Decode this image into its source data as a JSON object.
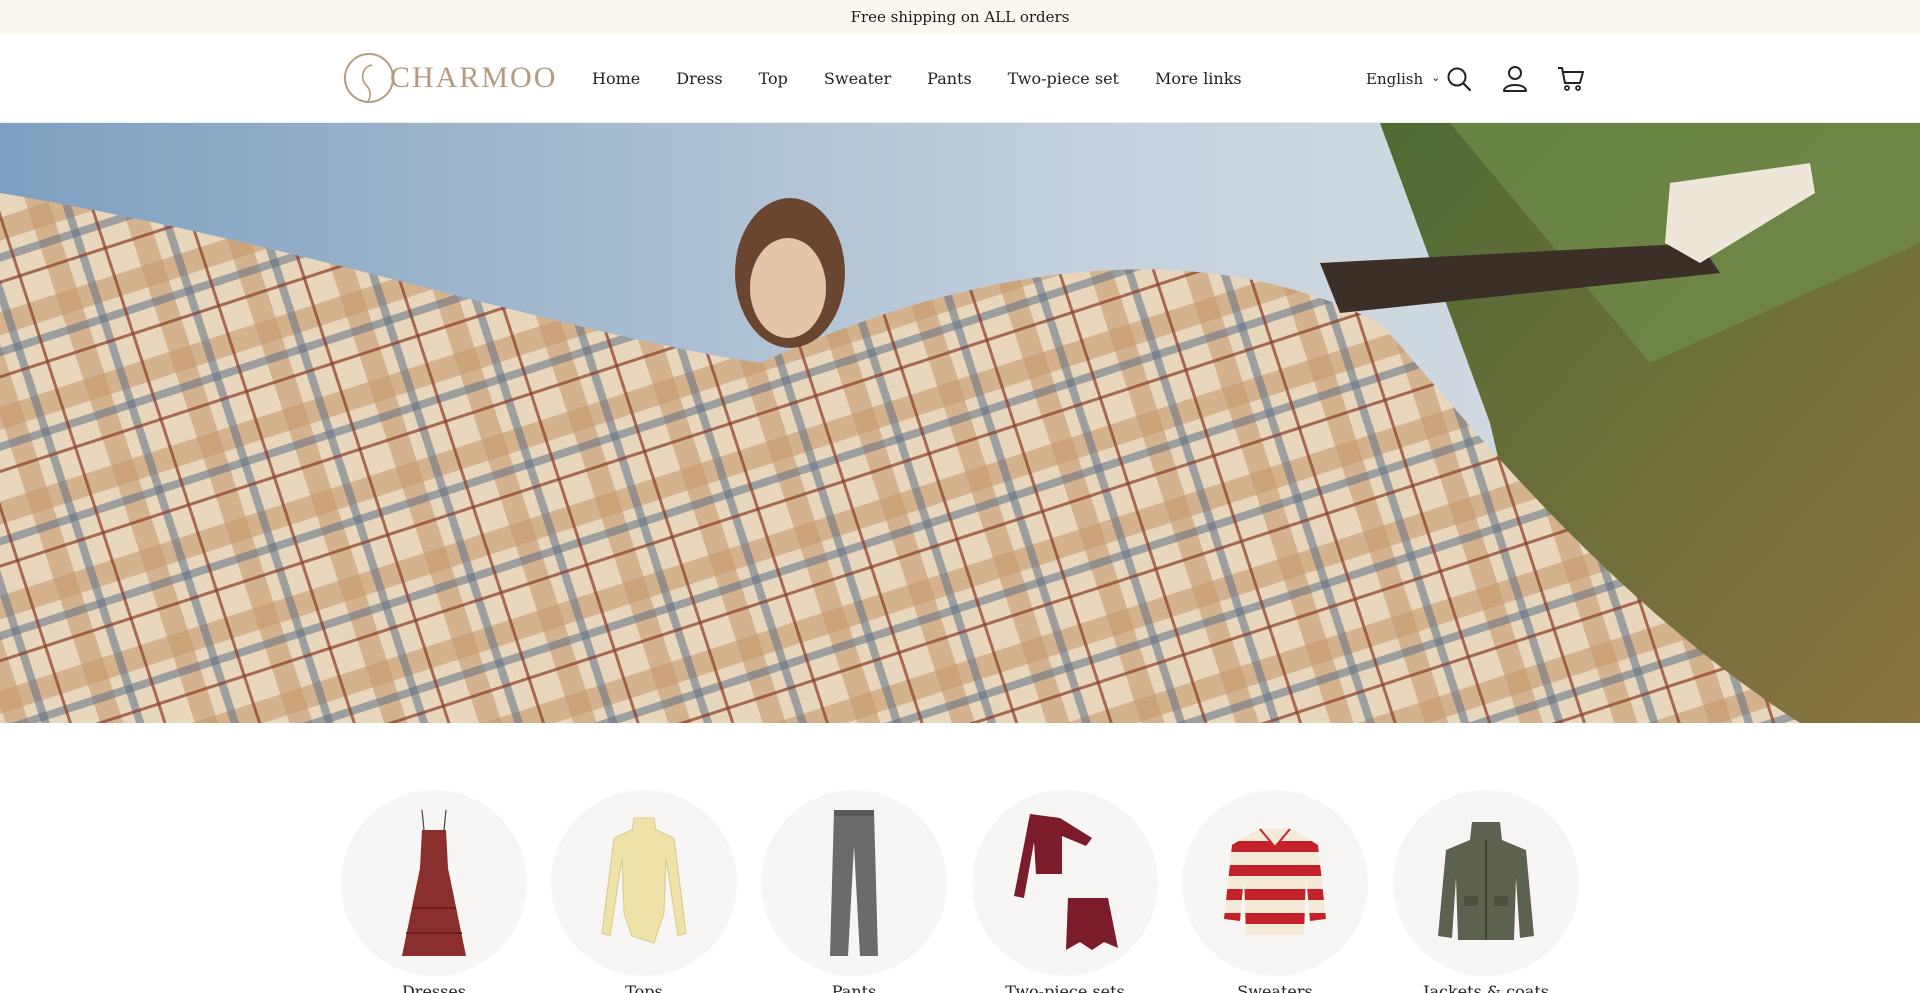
{
  "announcement": {
    "text": "Free shipping on ALL orders"
  },
  "header": {
    "logo_text": "CHARMOO",
    "nav": [
      "Home",
      "Dress",
      "Top",
      "Sweater",
      "Pants",
      "Two-piece set",
      "More links"
    ],
    "language": "English",
    "icons": [
      "search-icon",
      "account-icon",
      "cart-icon"
    ]
  },
  "hero": {
    "image": "woman-in-plaid-coat-on-hillside"
  },
  "categories": [
    {
      "label": "Dresses",
      "icon": "dress-icon"
    },
    {
      "label": "Tops",
      "icon": "top-icon"
    },
    {
      "label": "Pants",
      "icon": "pants-icon"
    },
    {
      "label": "Two-piece sets",
      "icon": "two-piece-icon"
    },
    {
      "label": "Sweaters",
      "icon": "sweater-icon"
    },
    {
      "label": "Jackets & coats",
      "icon": "jacket-icon"
    }
  ],
  "colors": {
    "announcement_bg": "#fdf8ef",
    "logo": "#b49a7f",
    "circle_bg": "#f7f6f5"
  }
}
